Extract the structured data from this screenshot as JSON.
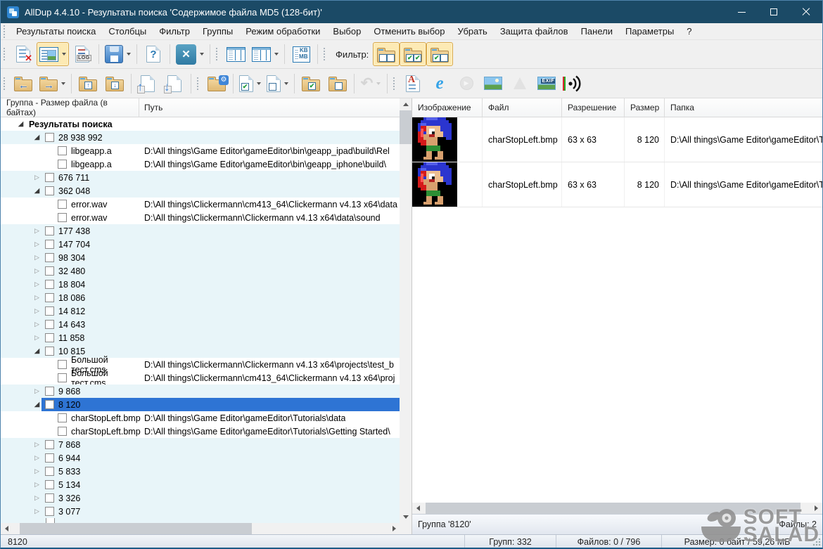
{
  "window": {
    "title": "AllDup 4.4.10 - Результаты поиска 'Содержимое файла MD5 (128-бит)'"
  },
  "menu": {
    "items": [
      "Результаты поиска",
      "Столбцы",
      "Фильтр",
      "Группы",
      "Режим обработки",
      "Выбор",
      "Отменить выбор",
      "Убрать",
      "Защита файлов",
      "Панели",
      "Параметры",
      "?"
    ]
  },
  "toolbar": {
    "filter_label": "Фильтр:",
    "log": "LOG",
    "kb": "KB",
    "mb": "MB",
    "exif": "EXIF"
  },
  "icons": {
    "question": "?",
    "x": "✕",
    "check": "✔",
    "arrow_left": "←",
    "arrow_right": "→",
    "arrow_up": "↑",
    "arrow_down": "↓",
    "undo": "↶",
    "gear": "⚙",
    "play": "▶",
    "ie": "e",
    "text_a": "A",
    "expand": "◢",
    "collapse": "▷"
  },
  "tree": {
    "columns": [
      "Группа - Размер файла (в байтах)",
      "Путь"
    ],
    "rows": [
      {
        "t": "root",
        "exp": true,
        "label": "Результаты поиска"
      },
      {
        "t": "group",
        "exp": true,
        "label": "28 938 992"
      },
      {
        "t": "file",
        "label": "libgeapp.a",
        "path": "D:\\All things\\Game Editor\\gameEditor\\bin\\geapp_ipad\\build\\Rel"
      },
      {
        "t": "file",
        "label": "libgeapp.a",
        "path": "D:\\All things\\Game Editor\\gameEditor\\bin\\geapp_iphone\\build\\"
      },
      {
        "t": "group",
        "exp": false,
        "label": "676 711"
      },
      {
        "t": "group",
        "exp": true,
        "label": "362 048"
      },
      {
        "t": "file",
        "label": "error.wav",
        "path": "D:\\All things\\Clickermann\\cm413_64\\Clickermann v4.13 x64\\data"
      },
      {
        "t": "file",
        "label": "error.wav",
        "path": "D:\\All things\\Clickermann\\Clickermann v4.13 x64\\data\\sound"
      },
      {
        "t": "group",
        "exp": false,
        "label": "177 438"
      },
      {
        "t": "group",
        "exp": false,
        "label": "147 704"
      },
      {
        "t": "group",
        "exp": false,
        "label": "98 304"
      },
      {
        "t": "group",
        "exp": false,
        "label": "32 480"
      },
      {
        "t": "group",
        "exp": false,
        "label": "18 804"
      },
      {
        "t": "group",
        "exp": false,
        "label": "18 086"
      },
      {
        "t": "group",
        "exp": false,
        "label": "14 812"
      },
      {
        "t": "group",
        "exp": false,
        "label": "14 643"
      },
      {
        "t": "group",
        "exp": false,
        "label": "11 858"
      },
      {
        "t": "group",
        "exp": true,
        "label": "10 815"
      },
      {
        "t": "file",
        "label": "Большой тест.cms",
        "path": "D:\\All things\\Clickermann\\Clickermann v4.13 x64\\projects\\test_b"
      },
      {
        "t": "file",
        "label": "Большой тест.cms",
        "path": "D:\\All things\\Clickermann\\cm413_64\\Clickermann v4.13 x64\\proj"
      },
      {
        "t": "group",
        "exp": false,
        "label": "9 868"
      },
      {
        "t": "group",
        "exp": true,
        "label": "8 120",
        "sel": true
      },
      {
        "t": "file",
        "label": "charStopLeft.bmp",
        "path": "D:\\All things\\Game Editor\\gameEditor\\Tutorials\\data"
      },
      {
        "t": "file",
        "label": "charStopLeft.bmp",
        "path": "D:\\All things\\Game Editor\\gameEditor\\Tutorials\\Getting Started\\"
      },
      {
        "t": "group",
        "exp": false,
        "label": "7 868"
      },
      {
        "t": "group",
        "exp": false,
        "label": "6 944"
      },
      {
        "t": "group",
        "exp": false,
        "label": "5 833"
      },
      {
        "t": "group",
        "exp": false,
        "label": "5 134"
      },
      {
        "t": "group",
        "exp": false,
        "label": "3 326"
      },
      {
        "t": "group",
        "exp": false,
        "label": "3 077"
      },
      {
        "t": "partial",
        "label": ""
      }
    ]
  },
  "preview": {
    "columns": [
      "Изображение",
      "Файл",
      "Разрешение",
      "Размер",
      "Папка"
    ],
    "rows": [
      {
        "file": "charStopLeft.bmp",
        "resolution": "63 x 63",
        "size": "8 120",
        "folder": "D:\\All things\\Game Editor\\gameEditor\\Tu"
      },
      {
        "file": "charStopLeft.bmp",
        "resolution": "63 x 63",
        "size": "8 120",
        "folder": "D:\\All things\\Game Editor\\gameEditor\\Tu"
      }
    ],
    "status_left": "Группа '8120'",
    "status_right": "Файлы: 2"
  },
  "statusbar": {
    "group": "8120",
    "groups": "Групп: 332",
    "files": "Файлов: 0 / 796",
    "size": "Размер: 0 байт / 59,26 МБ"
  },
  "watermark": {
    "line1": "SOFT",
    "line2": "SALAD"
  }
}
